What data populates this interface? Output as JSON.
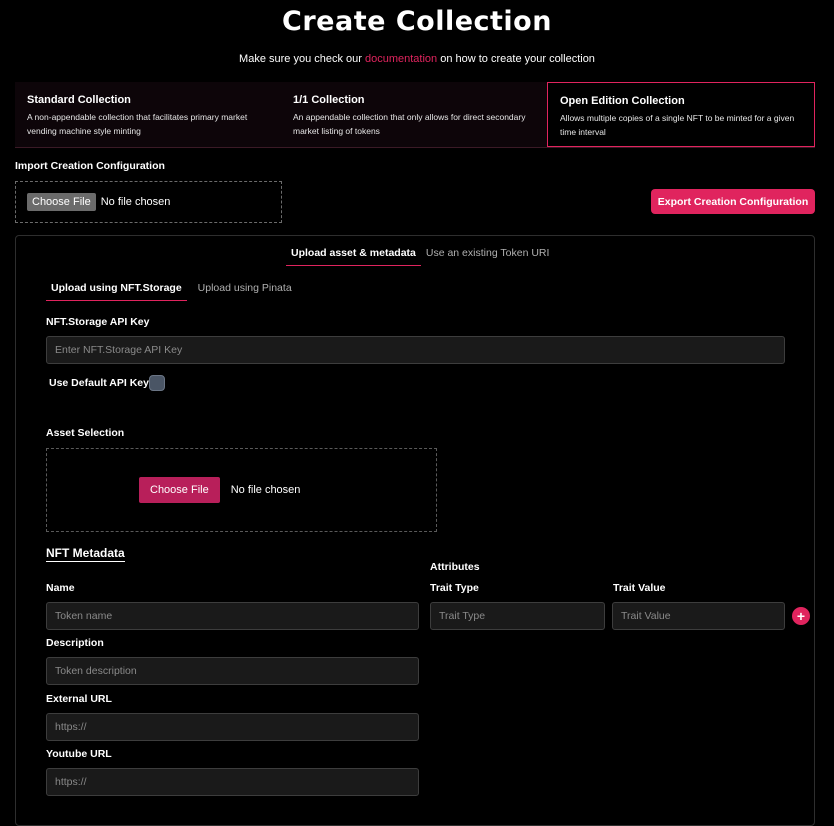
{
  "page": {
    "title": "Create Collection",
    "subtitle_pre": "Make sure you check our ",
    "subtitle_link": "documentation",
    "subtitle_post": " on how to create your collection"
  },
  "collection_types": [
    {
      "title": "Standard Collection",
      "desc": "A non-appendable collection that facilitates primary market vending machine style minting",
      "active": false
    },
    {
      "title": "1/1 Collection",
      "desc": "An appendable collection that only allows for direct secondary market listing of tokens",
      "active": false
    },
    {
      "title": "Open Edition Collection",
      "desc": "Allows multiple copies of a single NFT to be minted for a given time interval",
      "active": true
    }
  ],
  "import": {
    "label": "Import Creation Configuration",
    "choose_file": "Choose File",
    "no_file": "No file chosen"
  },
  "export_button": "Export Creation Configuration",
  "upload_tabs": [
    "Upload asset & metadata",
    "Use an existing Token URI"
  ],
  "storage_tabs": [
    "Upload using NFT.Storage",
    "Upload using Pinata"
  ],
  "api_key": {
    "label": "NFT.Storage API Key",
    "placeholder": "Enter NFT.Storage API Key",
    "default_label": "Use Default API Key"
  },
  "asset": {
    "label": "Asset Selection",
    "choose_file": "Choose File",
    "no_file": "No file chosen"
  },
  "metadata": {
    "title": "NFT Metadata",
    "name_label": "Name",
    "name_placeholder": "Token name",
    "desc_label": "Description",
    "desc_placeholder": "Token description",
    "ext_label": "External URL",
    "ext_placeholder": "https://",
    "yt_label": "Youtube URL",
    "yt_placeholder": "https://"
  },
  "attributes": {
    "title": "Attributes",
    "trait_type_label": "Trait Type",
    "trait_type_placeholder": "Trait Type",
    "trait_value_label": "Trait Value",
    "trait_value_placeholder": "Trait Value",
    "add": "+"
  },
  "colors": {
    "accent": "#e0245e",
    "background": "#000000",
    "input": "#1a1a1a"
  }
}
